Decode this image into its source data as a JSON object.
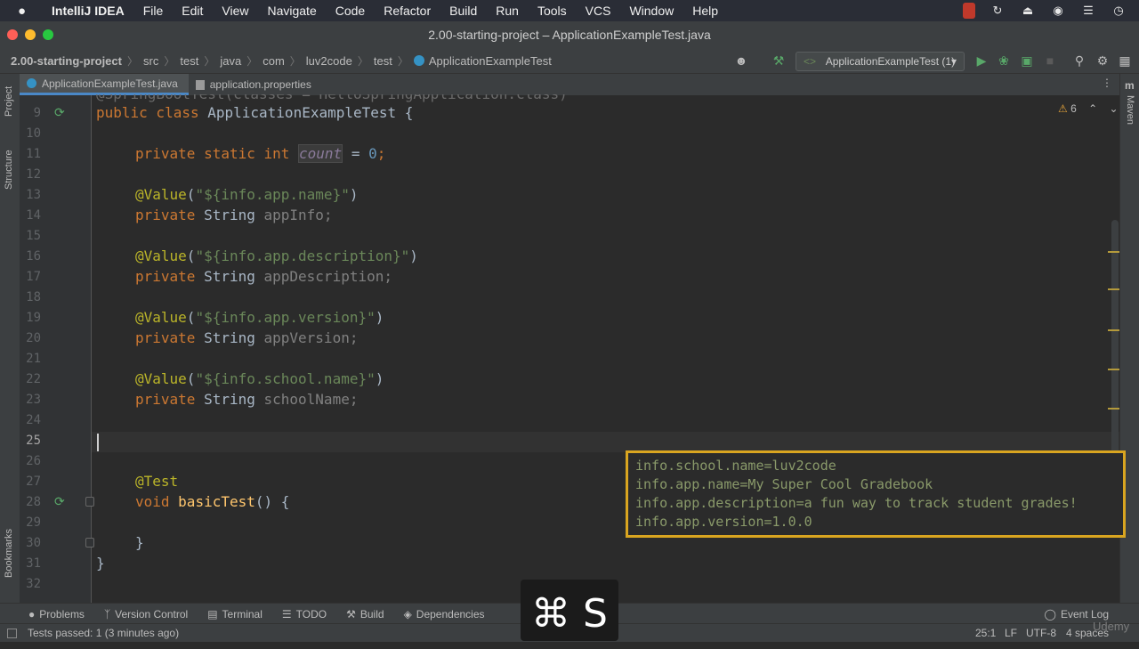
{
  "menubar": {
    "apple": "",
    "app": "IntelliJ IDEA",
    "items": [
      "File",
      "Edit",
      "View",
      "Navigate",
      "Code",
      "Refactor",
      "Build",
      "Run",
      "Tools",
      "VCS",
      "Window",
      "Help"
    ]
  },
  "window": {
    "title": "2.00-starting-project – ApplicationExampleTest.java"
  },
  "breadcrumb": {
    "project": "2.00-starting-project",
    "parts": [
      "src",
      "test",
      "java",
      "com",
      "luv2code",
      "test"
    ],
    "file": "ApplicationExampleTest"
  },
  "runconfig": {
    "label": "ApplicationExampleTest (1)"
  },
  "tabs": [
    {
      "label": "ApplicationExampleTest.java",
      "active": true
    },
    {
      "label": "application.properties",
      "active": false
    }
  ],
  "sidebar": {
    "project": "Project",
    "structure": "Structure",
    "bookmarks": "Bookmarks",
    "maven": "Maven"
  },
  "inspection": {
    "warnings": "6"
  },
  "code": {
    "lines": [
      "9",
      "10",
      "11",
      "12",
      "13",
      "14",
      "15",
      "16",
      "17",
      "18",
      "19",
      "20",
      "21",
      "22",
      "23",
      "24",
      "25",
      "26",
      "27",
      "28",
      "29",
      "30",
      "31",
      "32"
    ],
    "top_partial": "@SpringBootTest(classes = HelloSpringApplication.class)",
    "l9": {
      "kw": "public class ",
      "name": "ApplicationExampleTest {"
    },
    "l11": {
      "kw": "private static int ",
      "var": "count",
      "rest": " = ",
      "num": "0",
      "end": ";"
    },
    "l13": {
      "ann": "@Value",
      "p": "(",
      "str": "\"${info.app.name}\"",
      "e": ")"
    },
    "l14": {
      "kw": "private ",
      "type": "String ",
      "var": "appInfo;"
    },
    "l16": {
      "ann": "@Value",
      "p": "(",
      "str": "\"${info.app.description}\"",
      "e": ")"
    },
    "l17": {
      "kw": "private ",
      "type": "String ",
      "var": "appDescription;"
    },
    "l19": {
      "ann": "@Value",
      "p": "(",
      "str": "\"${info.app.version}\"",
      "e": ")"
    },
    "l20": {
      "kw": "private ",
      "type": "String ",
      "var": "appVersion;"
    },
    "l22": {
      "ann": "@Value",
      "p": "(",
      "str": "\"${info.school.name}\"",
      "e": ")"
    },
    "l23": {
      "kw": "private ",
      "type": "String ",
      "var": "schoolName;"
    },
    "l27": {
      "ann": "@Test"
    },
    "l28": {
      "kw": "void ",
      "name": "basicTest",
      "rest": "() {"
    },
    "l30": {
      "text": "}"
    },
    "l31": {
      "text": "}"
    }
  },
  "properties_popup": [
    "info.school.name=luv2code",
    "info.app.name=My Super Cool Gradebook",
    "info.app.description=a fun way to track student grades!",
    "info.app.version=1.0.0"
  ],
  "toolwindows": [
    "Problems",
    "Version Control",
    "Terminal",
    "TODO",
    "Build",
    "Dependencies"
  ],
  "eventlog": "Event Log",
  "status": {
    "message": "Tests passed: 1 (3 minutes ago)",
    "position": "25:1",
    "line_sep": "LF",
    "encoding": "UTF-8",
    "indent": "4 spaces"
  },
  "keystroke": "⌘ S",
  "watermark": "Udemy",
  "colors": {
    "accent": "#d9a520",
    "keyword": "#cc7832",
    "annotation": "#bbb529",
    "string": "#6a8759",
    "number": "#6897bb"
  }
}
